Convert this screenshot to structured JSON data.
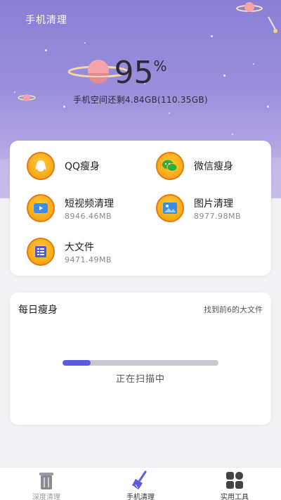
{
  "header": {
    "app_title": "手机清理",
    "percent_value": "95",
    "percent_unit": "%",
    "space_text": "手机空间还剩4.84GB(110.35GB)"
  },
  "tools": [
    {
      "name": "QQ瘦身",
      "size": "",
      "icon": "qq-icon"
    },
    {
      "name": "微信瘦身",
      "size": "",
      "icon": "wechat-icon"
    },
    {
      "name": "短视频清理",
      "size": "8946.46MB",
      "icon": "video-icon"
    },
    {
      "name": "图片清理",
      "size": "8977.98MB",
      "icon": "image-icon"
    },
    {
      "name": "大文件",
      "size": "9471.49MB",
      "icon": "file-icon"
    }
  ],
  "daily": {
    "title": "每日瘦身",
    "hint": "找到前6的大文件",
    "progress": 0.18,
    "scan_text": "正在扫描中"
  },
  "tabbar": {
    "items": [
      {
        "label": "深度清理",
        "icon": "trash-icon",
        "active": false
      },
      {
        "label": "手机清理",
        "icon": "broom-icon",
        "active": true
      },
      {
        "label": "实用工具",
        "icon": "grid-icon",
        "active": false
      }
    ]
  },
  "colors": {
    "hero_top": "#8a7ed6",
    "accent": "#5b5be0",
    "icon_orange": "#f6a818",
    "track": "#c9c9cf"
  }
}
